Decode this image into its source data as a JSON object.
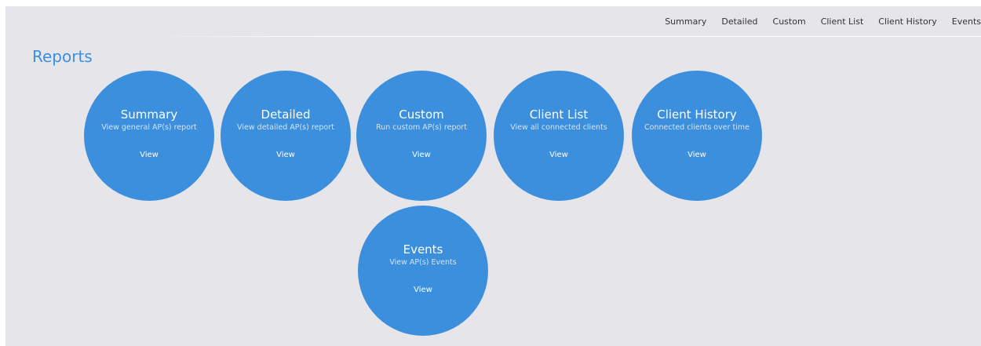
{
  "nav": {
    "items": [
      "Summary",
      "Detailed",
      "Custom",
      "Client List",
      "Client History",
      "Events"
    ]
  },
  "page": {
    "title": "Reports"
  },
  "cards": [
    {
      "title": "Summary",
      "description": "View general AP(s) report",
      "link": "View"
    },
    {
      "title": "Detailed",
      "description": "View detailed AP(s) report",
      "link": "View"
    },
    {
      "title": "Custom",
      "description": "Run custom AP(s) report",
      "link": "View"
    },
    {
      "title": "Client List",
      "description": "View all connected clients",
      "link": "View"
    },
    {
      "title": "Client History",
      "description": "Connected clients over time",
      "link": "View"
    },
    {
      "title": "Events",
      "description": "View AP(s) Events",
      "link": "View"
    }
  ],
  "colors": {
    "accent": "#3b8fdd",
    "background": "#e6e5ea",
    "nav_text": "#333333"
  }
}
